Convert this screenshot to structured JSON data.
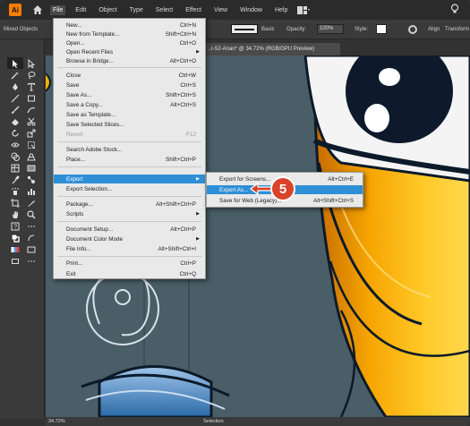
{
  "menubar": {
    "app_logo": "Ai",
    "items": [
      "File",
      "Edit",
      "Object",
      "Type",
      "Select",
      "Effect",
      "View",
      "Window",
      "Help"
    ]
  },
  "controlbar": {
    "mixed": "Mixed Objects",
    "basic": "Basic",
    "opacity_label": "Opacity:",
    "opacity_value": "100%",
    "style_label": "Style:",
    "align": "Align",
    "transform": "Transform"
  },
  "document_tab": "...r-52-Anan* @ 34.72% (RGB/GPU Preview)",
  "statusbar": {
    "zoom": "34.72%",
    "tool": "Selection"
  },
  "file_menu": {
    "items": [
      {
        "label": "New...",
        "shortcut": "Ctrl+N"
      },
      {
        "label": "New from Template...",
        "shortcut": "Shift+Ctrl+N"
      },
      {
        "label": "Open...",
        "shortcut": "Ctrl+O"
      },
      {
        "label": "Open Recent Files",
        "shortcut": ""
      },
      {
        "label": "Browse in Bridge...",
        "shortcut": "Alt+Ctrl+O"
      },
      {
        "label": "Close",
        "shortcut": "Ctrl+W"
      },
      {
        "label": "Save",
        "shortcut": "Ctrl+S"
      },
      {
        "label": "Save As...",
        "shortcut": "Shift+Ctrl+S"
      },
      {
        "label": "Save a Copy...",
        "shortcut": "Alt+Ctrl+S"
      },
      {
        "label": "Save as Template...",
        "shortcut": ""
      },
      {
        "label": "Save Selected Slices...",
        "shortcut": ""
      },
      {
        "label": "Revert",
        "shortcut": "F12"
      },
      {
        "label": "Search Adobe Stock...",
        "shortcut": ""
      },
      {
        "label": "Place...",
        "shortcut": "Shift+Ctrl+P"
      },
      {
        "label": "Export",
        "shortcut": ""
      },
      {
        "label": "Export Selection...",
        "shortcut": ""
      },
      {
        "label": "Package...",
        "shortcut": "Alt+Shift+Ctrl+P"
      },
      {
        "label": "Scripts",
        "shortcut": ""
      },
      {
        "label": "Document Setup...",
        "shortcut": "Alt+Ctrl+P"
      },
      {
        "label": "Document Color Mode",
        "shortcut": ""
      },
      {
        "label": "File Info...",
        "shortcut": "Alt+Shift+Ctrl+I"
      },
      {
        "label": "Print...",
        "shortcut": "Ctrl+P"
      },
      {
        "label": "Exit",
        "shortcut": "Ctrl+Q"
      }
    ]
  },
  "export_submenu": {
    "items": [
      {
        "label": "Export for Screens...",
        "shortcut": "Alt+Ctrl+E"
      },
      {
        "label": "Export As...",
        "shortcut": ""
      },
      {
        "label": "Save for Web (Legacy)...",
        "shortcut": "Alt+Shift+Ctrl+S"
      }
    ]
  },
  "callout": {
    "step": "5",
    "color": "#d9432b"
  },
  "colors": {
    "highlight": "#2f8fd6",
    "canvas": "#4a5e68",
    "yellow": "#f6b100"
  }
}
